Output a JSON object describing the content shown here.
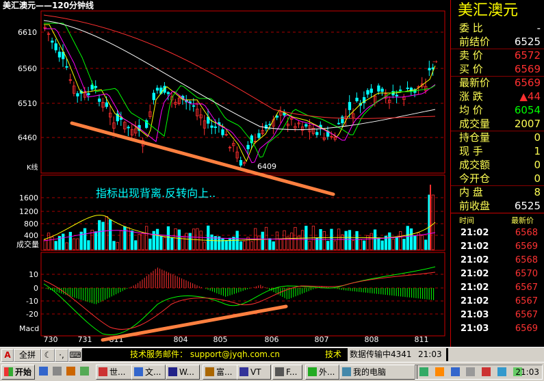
{
  "chart": {
    "title": "美汇澳元——120分钟线",
    "price_ticks": [
      "6610",
      "6560",
      "6510",
      "6460"
    ],
    "kline_label": "K线",
    "low_annotation": "6409",
    "annotation_text": "指标出现背离.反转向上..",
    "volume_ticks": [
      "1600",
      "1200",
      "800",
      "400"
    ],
    "volume_label": "成交量",
    "macd_ticks": [
      "10",
      "0",
      "-10",
      "-20"
    ],
    "macd_label": "Macd",
    "date_labels": [
      "730",
      "731",
      "811",
      "804",
      "805",
      "806",
      "807",
      "808",
      "811"
    ],
    "colors": {
      "up": "#ff3030",
      "down": "#00ffff",
      "ma1": "#ffffff",
      "ma2": "#ffff00",
      "ma3": "#ff00ff",
      "ma4": "#00ff00",
      "ma5": "#ff3030",
      "trend": "#ff8040"
    }
  },
  "quote": {
    "title": "美汇澳元",
    "rows": [
      {
        "label": "委  比",
        "value": "-",
        "color": "#ffffff"
      },
      {
        "label": "前结价",
        "value": "6525",
        "color": "#ffffff"
      },
      {
        "label": "卖  价",
        "value": "6572",
        "color": "#ff3030"
      },
      {
        "label": "买  价",
        "value": "6569",
        "color": "#ff3030"
      },
      {
        "label": "最新价",
        "value": "6569",
        "color": "#ff3030"
      },
      {
        "label": "涨  跌",
        "value": "▲44",
        "color": "#ff3030"
      },
      {
        "label": "均  价",
        "value": "6054",
        "color": "#00ff00"
      },
      {
        "label": "成交量",
        "value": "2007",
        "color": "#ffff55"
      },
      {
        "label": "持仓量",
        "value": "0",
        "color": "#ffff55"
      },
      {
        "label": "现  手",
        "value": "1",
        "color": "#ffff55"
      },
      {
        "label": "成交额",
        "value": "0",
        "color": "#ffff55"
      },
      {
        "label": "今开仓",
        "value": "0",
        "color": "#ffff55"
      },
      {
        "label": "内  盘",
        "value": "8",
        "color": "#ffff55"
      },
      {
        "label": "前收盘",
        "value": "6525",
        "color": "#ffffff"
      }
    ],
    "ticks_header": {
      "time": "时间",
      "price": "最新价"
    },
    "ticks": [
      {
        "time": "21:02",
        "price": "6568"
      },
      {
        "time": "21:02",
        "price": "6569"
      },
      {
        "time": "21:02",
        "price": "6568"
      },
      {
        "time": "21:02",
        "price": "6570"
      },
      {
        "time": "21:02",
        "price": "6567"
      },
      {
        "time": "21:02",
        "price": "6567"
      },
      {
        "time": "21:03",
        "price": "6567"
      },
      {
        "time": "21:03",
        "price": "6569"
      }
    ]
  },
  "status_bar": {
    "btn_a": "A",
    "btn_full": "全拼",
    "support": "技术服务邮件：  support@jyqh.com.cn",
    "tech": "技术",
    "transfer": "数据传输中4341",
    "clock": "21:03"
  },
  "taskbar": {
    "start": "开始",
    "items": [
      "世...",
      "文...",
      "W...",
      "富...",
      "VT",
      "F...",
      "外..."
    ],
    "my_computer": "我的电脑",
    "time": "21:03"
  }
}
